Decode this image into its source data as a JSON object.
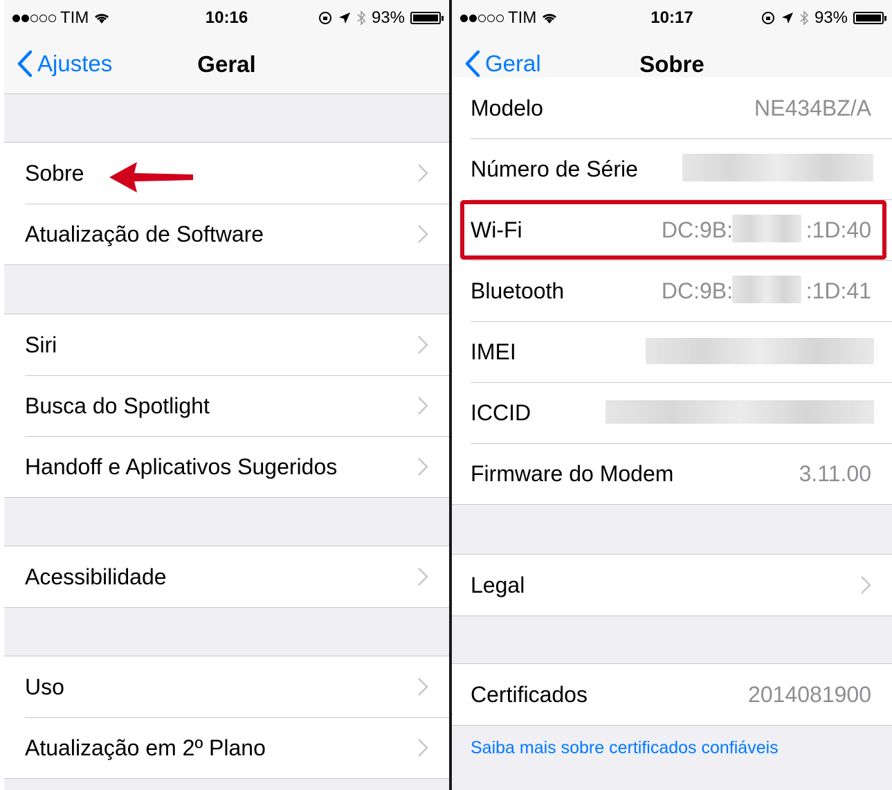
{
  "left": {
    "status": {
      "carrier": "TIM",
      "time": "10:16",
      "battery": "93%"
    },
    "nav": {
      "back": "Ajustes",
      "title": "Geral"
    },
    "rows": [
      {
        "label": "Sobre"
      },
      {
        "label": "Atualização de Software"
      },
      {
        "label": "Siri"
      },
      {
        "label": "Busca do Spotlight"
      },
      {
        "label": "Handoff e Aplicativos Sugeridos"
      },
      {
        "label": "Acessibilidade"
      },
      {
        "label": "Uso"
      },
      {
        "label": "Atualização em 2º Plano"
      }
    ]
  },
  "right": {
    "status": {
      "carrier": "TIM",
      "time": "10:17",
      "battery": "93%"
    },
    "nav": {
      "back": "Geral",
      "title": "Sobre"
    },
    "rows": [
      {
        "label": "Modelo",
        "value": "NE434BZ/A"
      },
      {
        "label": "Número de Série"
      },
      {
        "label": "Wi-Fi",
        "value_start": "DC:9B:",
        "value_end": ":1D:40"
      },
      {
        "label": "Bluetooth",
        "value_start": "DC:9B:",
        "value_end": ":1D:41"
      },
      {
        "label": "IMEI"
      },
      {
        "label": "ICCID"
      },
      {
        "label": "Firmware do Modem",
        "value": "3.11.00"
      },
      {
        "label": "Legal"
      },
      {
        "label": "Certificados",
        "value": "2014081900"
      }
    ],
    "footer_link": "Saiba mais sobre certificados confiáveis"
  },
  "colors": {
    "accent": "#007aff",
    "highlight": "#d0021b",
    "arrow": "#d0021b"
  }
}
